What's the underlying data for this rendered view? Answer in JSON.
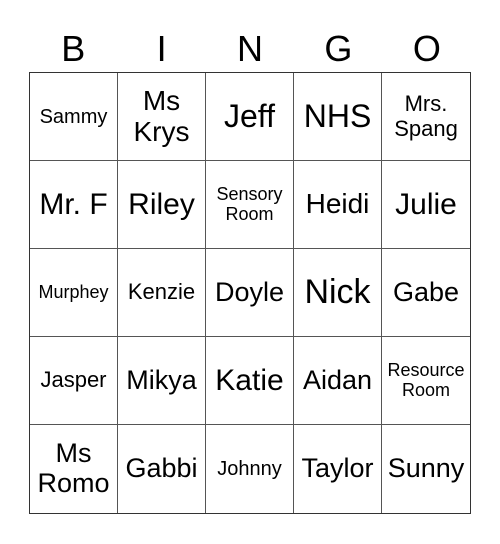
{
  "header": {
    "letters": [
      "B",
      "I",
      "N",
      "G",
      "O"
    ]
  },
  "cells": [
    [
      "Sammy",
      "Ms\nKrys",
      "Jeff",
      "NHS",
      "Mrs.\nSpang"
    ],
    [
      "Mr. F",
      "Riley",
      "Sensory\nRoom",
      "Heidi",
      "Julie"
    ],
    [
      "Murphey",
      "Kenzie",
      "Doyle",
      "Nick",
      "Gabe"
    ],
    [
      "Jasper",
      "Mikya",
      "Katie",
      "Aidan",
      "Resource\nRoom"
    ],
    [
      "Ms\nRomo",
      "Gabbi",
      "Johnny",
      "Taylor",
      "Sunny"
    ]
  ]
}
